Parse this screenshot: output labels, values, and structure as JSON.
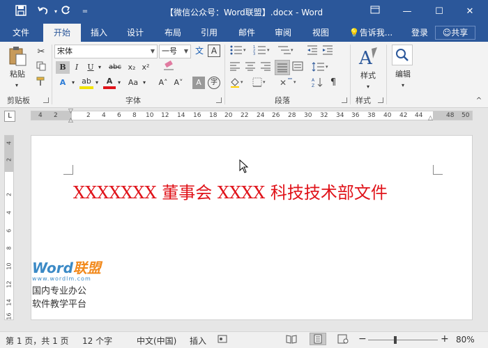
{
  "window": {
    "title": "【微信公众号：Word联盟】.docx - Word",
    "accent_color": "#2b579a"
  },
  "quick_access": {
    "icons": [
      "save-icon",
      "undo-icon",
      "redo-icon",
      "customize-icon"
    ]
  },
  "tabs": [
    {
      "label": "文件"
    },
    {
      "label": "开始"
    },
    {
      "label": "插入"
    },
    {
      "label": "设计"
    },
    {
      "label": "布局"
    },
    {
      "label": "引用"
    },
    {
      "label": "邮件"
    },
    {
      "label": "审阅"
    },
    {
      "label": "视图"
    }
  ],
  "tell_me": "告诉我...",
  "login": "登录",
  "share": "共享",
  "ribbon": {
    "clipboard": {
      "paste": "粘贴",
      "group": "剪贴板"
    },
    "font": {
      "font_name": "宋体",
      "font_size": "一号",
      "phonetic": "文",
      "bold": "B",
      "italic": "I",
      "underline": "U",
      "strike": "abc",
      "subscript": "x₂",
      "superscript": "x²",
      "text_effect": "A",
      "highlight": "ab",
      "font_color": "A",
      "case": "Aa",
      "grow": "A˄",
      "shrink": "A˅",
      "char_shade": "A",
      "enclose": "字",
      "border": "A",
      "group": "字体"
    },
    "paragraph": {
      "group": "段落"
    },
    "styles": {
      "label": "样式",
      "group": "样式"
    },
    "editing": {
      "label": "编辑"
    }
  },
  "ruler": {
    "h_ticks": [
      "4",
      "2",
      "2",
      "4",
      "6",
      "8",
      "10",
      "12",
      "14",
      "16",
      "18",
      "20",
      "22",
      "24",
      "26",
      "28",
      "30",
      "32",
      "34",
      "36",
      "38",
      "40",
      "42",
      "44",
      "48",
      "50"
    ],
    "v_ticks": [
      "4",
      "2",
      "2",
      "4",
      "6",
      "8",
      "10",
      "12",
      "14",
      "16"
    ],
    "corner": "L"
  },
  "document": {
    "heading": "XXXXXXX 董事会 XXXX 科技技术部文件",
    "heading_color": "#e0131a"
  },
  "watermark": {
    "logo_word": "Word",
    "logo_cn": "联盟",
    "url": "www.wordlm.com",
    "line1": "国内专业办公",
    "line2": "软件教学平台"
  },
  "status": {
    "page": "第 1 页，共 1 页",
    "words": "12 个字",
    "language": "中文(中国)",
    "mode": "插入",
    "zoom": "80%",
    "zoom_minus": "−",
    "zoom_plus": "+"
  }
}
